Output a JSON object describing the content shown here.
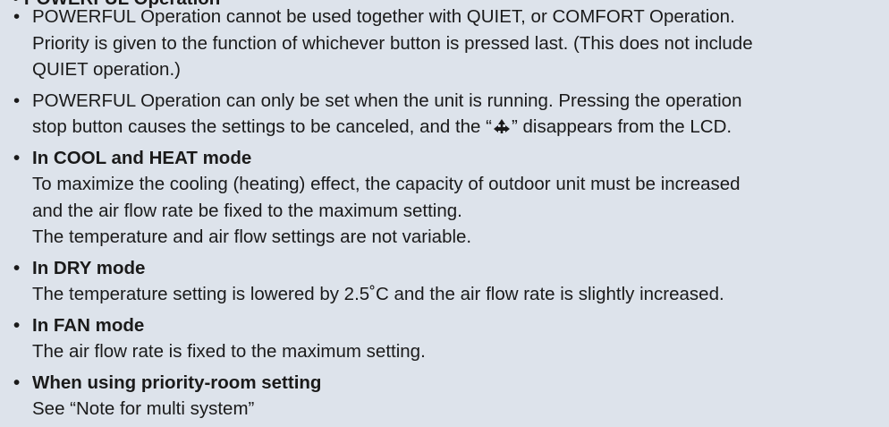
{
  "section": {
    "heading_partial": "POWERFUL Operation"
  },
  "notes": [
    {
      "lines": [
        "POWERFUL Operation cannot be used together with QUIET, or COMFORT Operation.",
        "Priority is given to the function of whichever button is pressed last. (This does not include",
        "QUIET operation.)"
      ]
    },
    {
      "line1": "POWERFUL Operation can only be set when the unit is running. Pressing the operation",
      "line2_before": "stop button causes the settings to be canceled, and the “",
      "line2_after": "” disappears from the LCD.",
      "symbol_icon": "powerful-mode-icon"
    },
    {
      "title": "In COOL and HEAT mode",
      "lines": [
        "To maximize the cooling (heating) effect, the capacity of outdoor unit must be increased",
        "and the air flow rate be fixed to the maximum setting.",
        "The temperature and air flow settings are not variable."
      ]
    },
    {
      "title": "In DRY mode",
      "lines": [
        "The temperature setting is lowered by 2.5˚C and the air flow rate is slightly increased."
      ]
    },
    {
      "title": "In FAN mode",
      "lines": [
        "The air flow rate is fixed to the maximum setting."
      ]
    },
    {
      "title": "When using priority-room setting",
      "lines": [
        "See “Note for multi system”"
      ]
    }
  ],
  "bullet_char": "•",
  "colors": {
    "background": "#dde3eb",
    "text": "#1a1a1a"
  }
}
